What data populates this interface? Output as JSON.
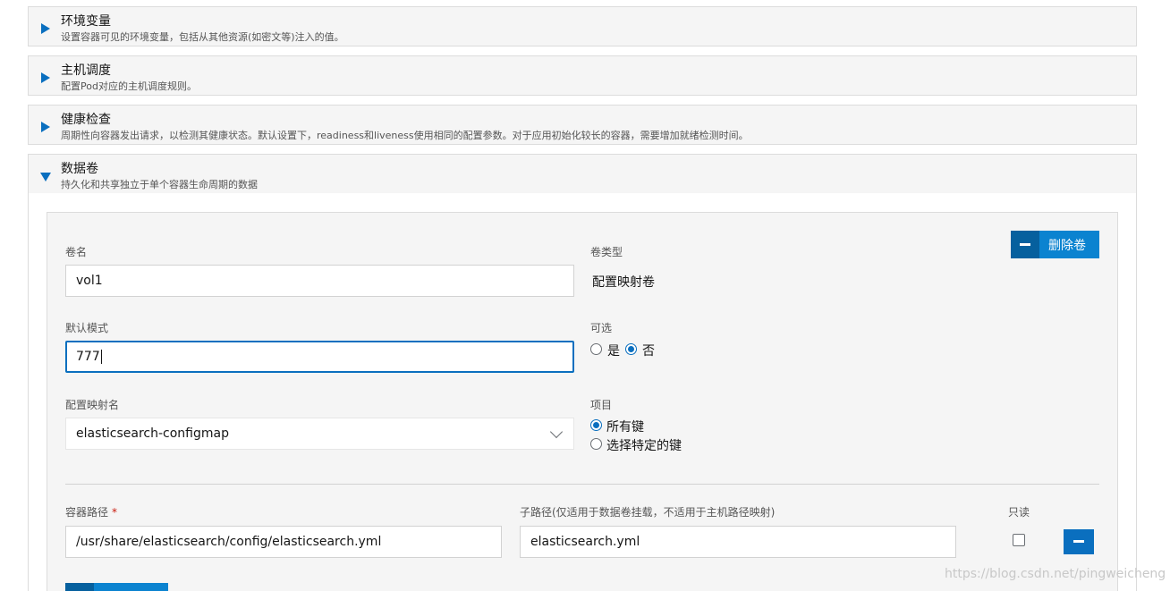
{
  "sections": {
    "env": {
      "title": "环境变量",
      "desc": "设置容器可见的环境变量，包括从其他资源(如密文等)注入的值。"
    },
    "scheduling": {
      "title": "主机调度",
      "desc": "配置Pod对应的主机调度规则。"
    },
    "health": {
      "title": "健康检查",
      "desc": "周期性向容器发出请求，以检测其健康状态。默认设置下，readiness和liveness使用相同的配置参数。对于应用初始化较长的容器，需要增加就绪检测时间。"
    },
    "volumes": {
      "title": "数据卷",
      "desc": "持久化和共享独立于单个容器生命周期的数据"
    }
  },
  "volume": {
    "name_label": "卷名",
    "name_value": "vol1",
    "type_label": "卷类型",
    "type_value": "配置映射卷",
    "remove_label": "删除卷",
    "mode_label": "默认模式",
    "mode_value": "777",
    "optional_label": "可选",
    "optional_yes": "是",
    "optional_no": "否",
    "configmap_label": "配置映射名",
    "configmap_value": "elasticsearch-configmap",
    "items_label": "项目",
    "items_all": "所有键",
    "items_specific": "选择特定的键"
  },
  "mount": {
    "path_label": "容器路径",
    "required_mark": "*",
    "path_value": "/usr/share/elasticsearch/config/elasticsearch.yml",
    "subpath_label": "子路径(仅适用于数据卷挂载，不适用于主机路径映射)",
    "subpath_value": "elasticsearch.yml",
    "readonly_label": "只读"
  },
  "watermark": "https://blog.csdn.net/pingweicheng",
  "icons": {
    "collapsed": "caret-right-icon",
    "expanded": "caret-down-icon",
    "minus": "minus-icon",
    "dropdown": "chevron-down-icon"
  },
  "colors": {
    "accent": "#0a6fbf",
    "button": "#0b83d0",
    "button_dark": "#06609e",
    "required": "#c9190b"
  }
}
